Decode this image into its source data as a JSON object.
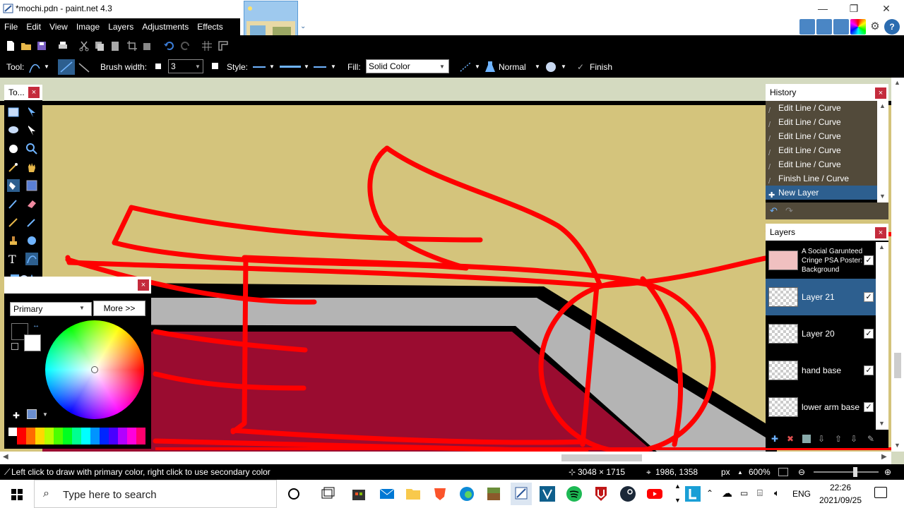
{
  "window": {
    "title": "*mochi.pdn - paint.net 4.3",
    "minimize": "—",
    "maximize": "❐",
    "close": "✕"
  },
  "menu": [
    "File",
    "Edit",
    "View",
    "Image",
    "Layers",
    "Adjustments",
    "Effects"
  ],
  "toolbar": {
    "tool_label": "Tool:",
    "brush_width_label": "Brush width:",
    "brush_width_value": "3",
    "style_label": "Style:",
    "fill_label": "Fill:",
    "fill_value": "Solid Color",
    "blend_mode": "Normal",
    "finish_label": "Finish"
  },
  "tools_panel": {
    "title": "To...",
    "close": "×"
  },
  "colors_panel": {
    "close": "×",
    "mode_select": "Primary",
    "more_button": "More >>",
    "primary_color": "#000000",
    "secondary_color": "#ffffff",
    "palette": [
      "#ffffff",
      "#000000",
      "#ff0000",
      "#ff6a00",
      "#ffd800",
      "#b6ff00",
      "#4cff00",
      "#00ff21",
      "#00ff90",
      "#00ffff",
      "#0094ff",
      "#0026ff",
      "#4800ff",
      "#b200ff",
      "#ff00dc",
      "#ff006e"
    ]
  },
  "history_panel": {
    "title": "History",
    "close": "×",
    "items": [
      {
        "label": "Edit Line / Curve"
      },
      {
        "label": "Edit Line / Curve"
      },
      {
        "label": "Edit Line / Curve"
      },
      {
        "label": "Edit Line / Curve"
      },
      {
        "label": "Edit Line / Curve"
      },
      {
        "label": "Finish Line / Curve"
      },
      {
        "label": "New Layer"
      }
    ],
    "selected_index": 6
  },
  "layers_panel": {
    "title": "Layers",
    "close": "×",
    "layers": [
      {
        "name": "A Social Garunteed Cringe PSA Poster: Background",
        "visible": true,
        "selected": false
      },
      {
        "name": "Layer 21",
        "visible": true,
        "selected": true
      },
      {
        "name": "Layer 20",
        "visible": true,
        "selected": false
      },
      {
        "name": "hand base",
        "visible": true,
        "selected": false
      },
      {
        "name": "lower arm base",
        "visible": true,
        "selected": false
      }
    ]
  },
  "statusbar": {
    "hint": "Left click to draw with primary color, right click to use secondary color",
    "image_size": "3048 × 1715",
    "cursor_pos": "1986, 1358",
    "units": "px",
    "zoom": "600%"
  },
  "taskbar": {
    "search_placeholder": "Type here to search",
    "language": "ENG",
    "time": "22:26",
    "date": "2021/09/25"
  },
  "colors": {
    "canvas_bg": "#d4c47c",
    "stroke_red": "#ff0000",
    "crimson": "#9a0c30",
    "gray_band": "#b4b4b4",
    "selection": "#2d5f8f"
  }
}
